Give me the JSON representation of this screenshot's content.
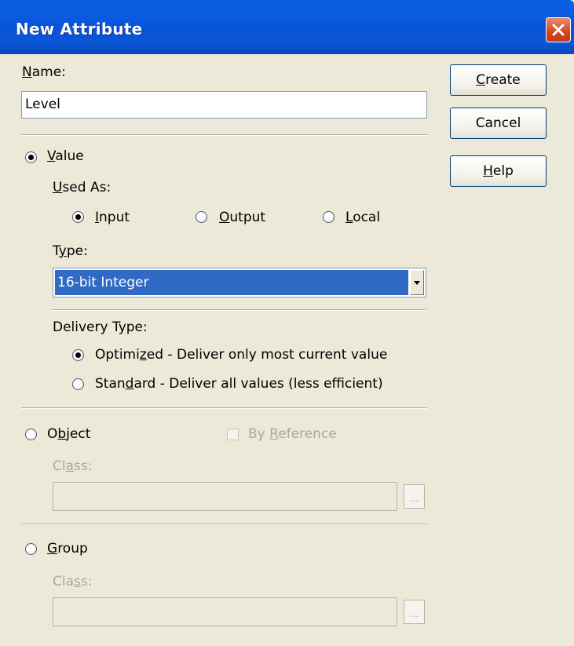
{
  "window": {
    "title": "New Attribute"
  },
  "name_field": {
    "label_prefix": "",
    "label_accel": "N",
    "label_rest": "ame:",
    "value": "Level"
  },
  "buttons": {
    "create": "Create",
    "cancel": "Cancel",
    "help": "Help"
  },
  "value_option": {
    "accel": "V",
    "rest": "alue",
    "selected": true
  },
  "used_as": {
    "label_accel": "U",
    "label_rest": "sed As:",
    "options": [
      {
        "accel": "I",
        "rest": "nput",
        "selected": true
      },
      {
        "accel": "O",
        "rest": "utput",
        "selected": false
      },
      {
        "accel": "L",
        "rest": "ocal",
        "selected": false
      }
    ]
  },
  "type": {
    "label_pre": "T",
    "label_accel": "y",
    "label_rest": "pe:",
    "selected": "16-bit Integer"
  },
  "delivery": {
    "label": "Delivery Type:",
    "optimized": {
      "pre": "Optimi",
      "accel": "z",
      "rest": "ed - Deliver only most current value",
      "selected": true
    },
    "standard": {
      "pre": "Stan",
      "accel": "d",
      "rest": "ard - Deliver all values (less efficient)",
      "selected": false
    }
  },
  "object_option": {
    "pre": "O",
    "accel": "b",
    "rest": "ject",
    "selected": false,
    "by_reference": {
      "pre": "By ",
      "accel": "R",
      "rest": "eference",
      "checked": false
    },
    "class_label": {
      "pre": "Cl",
      "accel": "a",
      "rest": "ss:"
    },
    "browse": "..."
  },
  "group_option": {
    "accel": "G",
    "rest": "roup",
    "selected": false,
    "class_label": {
      "pre": "Cla",
      "accel": "s",
      "rest": "s:"
    },
    "browse": "..."
  }
}
